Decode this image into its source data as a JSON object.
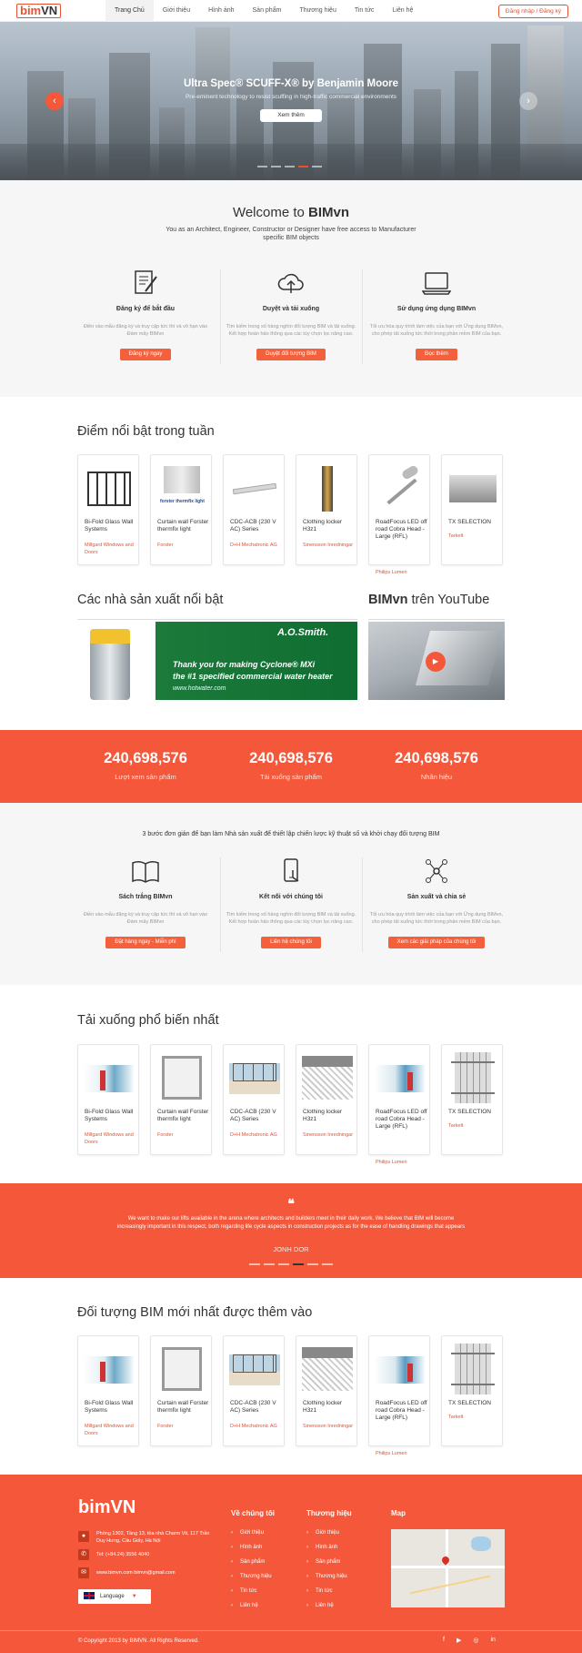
{
  "header": {
    "logo_a": "bim",
    "logo_b": "VN",
    "nav": [
      "Trang Chủ",
      "Giới thiệu",
      "Hình ảnh",
      "Sản phẩm",
      "Thương hiệu",
      "Tin tức",
      "Liên hệ"
    ],
    "auth": "Đăng nhập / Đăng ký"
  },
  "hero": {
    "title": "Ultra Spec® SCUFF-X® by Benjamin Moore",
    "subtitle": "Pre-eminent technology to resist scuffing in high-traffic commercial environments",
    "button": "Xem thêm",
    "prev_icon": "chevron-left-icon",
    "next_icon": "chevron-right-icon",
    "slides_total": 5,
    "slide_active": 4
  },
  "welcome": {
    "title_a": "Welcome to ",
    "title_b": "BIMvn",
    "desc": "You as an Architect, Engineer, Constructor or Designer have free access to Manufacturer specific BIM objects",
    "features": [
      {
        "icon": "document-edit-icon",
        "title": "Đăng ký để bắt đầu",
        "desc": "Điền vào mẫu đăng ký và truy cập tức thì và vô hạn vào Đám mây BIMvn",
        "button": "Đăng ký ngay"
      },
      {
        "icon": "cloud-upload-icon",
        "title": "Duyệt và tải xuống",
        "desc": "Tìm kiếm trong số hàng nghìn đối tượng BIM và tải xuống. Kết hợp hoàn hảo thông qua các tùy chọn lọc nâng cao.",
        "button": "Duyệt đối tượng BIM"
      },
      {
        "icon": "laptop-icon",
        "title": "Sử dụng ứng dụng BIMvn",
        "desc": "Tối ưu hóa quy trình làm việc của bạn với Ứng dụng BIMvn, cho phép tải xuống tức thời trong phần mềm BIM của bạn.",
        "button": "Đọc thêm"
      }
    ]
  },
  "featured": {
    "title": "Điểm nổi bật trong tuần",
    "items": [
      {
        "name": "Bi-Fold Glass Wall Systems",
        "maker": "Millgard Windows and Doors"
      },
      {
        "name": "Curtain wall Forster thermfix light",
        "maker": "Forster"
      },
      {
        "name": "CDC-ACB (230 V AC) Series",
        "maker": "D+H Mechatronic AG"
      },
      {
        "name": "Clothing locker H3z1",
        "maker": "Sinensson Inredningar"
      },
      {
        "name": "RoadFocus LED off road Cobra Head - Large (RFL)",
        "maker": "Philips Lumen"
      },
      {
        "name": "TX SELECTION",
        "maker": "Tarkett"
      }
    ]
  },
  "manufacturers": {
    "title": "Các nhà sản xuất nổi bật",
    "banner_brand": "A.O.Smith.",
    "banner_line1": "Thank you for making Cyclone® MXi",
    "banner_line2": "the #1 specified commercial water heater",
    "banner_url": "www.hotwater.com"
  },
  "youtube": {
    "title_a": "BIMvn",
    "title_b": " trên YouTube",
    "play_icon": "play-icon"
  },
  "stats": [
    {
      "value": "240,698,576",
      "label": "Lượt xem sản phẩm"
    },
    {
      "value": "240,698,576",
      "label": "Tải xuống sản phẩm"
    },
    {
      "value": "240,698,576",
      "label": "Nhãn hiệu"
    }
  ],
  "steps": {
    "intro": "3 bước đơn giản để bạn làm Nhà sản xuất để thiết lập chiến lược kỹ thuật số và khởi chạy đối tượng BIM",
    "items": [
      {
        "icon": "book-icon",
        "title": "Sách trắng BIMvn",
        "desc": "Điền vào mẫu đăng ký và truy cập tức thì và vô hạn vào Đám mây BIMvn",
        "button": "Đặt hàng ngay - Miễn phí"
      },
      {
        "icon": "phone-touch-icon",
        "title": "Kết nối với chúng tôi",
        "desc": "Tìm kiếm trong số hàng nghìn đối tượng BIM và tải xuống. Kết hợp hoàn hảo thông qua các tùy chọn lọc nâng cao.",
        "button": "Liên hệ chúng tôi"
      },
      {
        "icon": "network-icon",
        "title": "Sản xuất và chia sẻ",
        "desc": "Tối ưu hóa quy trình làm việc của bạn với Ứng dụng BIMvn, cho phép tải xuống tức thời trong phần mềm BIM của bạn.",
        "button": "Xem các giải pháp của chúng tôi"
      }
    ]
  },
  "popular": {
    "title": "Tải xuống phổ biến nhất",
    "items": [
      {
        "name": "Bi-Fold Glass Wall Systems",
        "maker": "Millgard Windows and Doors"
      },
      {
        "name": "Curtain wall Forster thermfix light",
        "maker": "Forster"
      },
      {
        "name": "CDC-ACB (230 V AC) Series",
        "maker": "D+H Mechatronic AG"
      },
      {
        "name": "Clothing locker H3z1",
        "maker": "Sinensson Inredningar"
      },
      {
        "name": "RoadFocus LED off road Cobra Head - Large (RFL)",
        "maker": "Philips Lumen"
      },
      {
        "name": "TX SELECTION",
        "maker": "Tarkett"
      }
    ]
  },
  "quote": {
    "icon": "quote-icon",
    "text": "We want to make our lifts available in the arena where architects and builders meet in their daily work. We believe that BIM will become increasingly important in this respect, both regarding life cycle aspects in construction projects as for the ease of handling drawings that appears",
    "author": "JONH DOR",
    "slides_total": 6,
    "slide_active": 4
  },
  "newest": {
    "title": "Đối tượng BIM mới nhất được thêm vào",
    "items": [
      {
        "name": "Bi-Fold Glass Wall Systems",
        "maker": "Millgard Windows and Doors"
      },
      {
        "name": "Curtain wall Forster thermfix light",
        "maker": "Forster"
      },
      {
        "name": "CDC-ACB (230 V AC) Series",
        "maker": "D+H Mechatronic AG"
      },
      {
        "name": "Clothing locker H3z1",
        "maker": "Sinensson Inredningar"
      },
      {
        "name": "RoadFocus LED off road Cobra Head - Large (RFL)",
        "maker": "Philips Lumen"
      },
      {
        "name": "TX SELECTION",
        "maker": "Tarkett"
      }
    ]
  },
  "footer": {
    "logo": "bimVN",
    "address": "Phòng 1302, Tầng 13, tòa nhà Charm Vit, 117 Trần Duy Hưng, Cầu Giấy, Hà Nội",
    "phone": "Tel: (+84.24) 3556 4040",
    "email": "www.bimvn.com bimvn@gmail.com",
    "language": "Language",
    "about_title": "Về chúng tôi",
    "about_links": [
      "Giới thiệu",
      "Hình ảnh",
      "Sản phẩm",
      "Thương hiệu",
      "Tin tức",
      "Liên hệ"
    ],
    "brand_title": "Thương hiệu",
    "brand_links": [
      "Giới thiệu",
      "Hình ảnh",
      "Sản phẩm",
      "Thương hiệu",
      "Tin tức",
      "Liên hệ"
    ],
    "map_title": "Map",
    "copyright": "© Copyright 2013 by BIMVN. All Rights Reserved.",
    "social": [
      "facebook-icon",
      "youtube-icon",
      "instagram-icon",
      "linkedin-icon"
    ]
  },
  "colors": {
    "accent": "#f4573a",
    "accent_dark": "#e8512f",
    "light_bg": "#f6f6f6"
  }
}
